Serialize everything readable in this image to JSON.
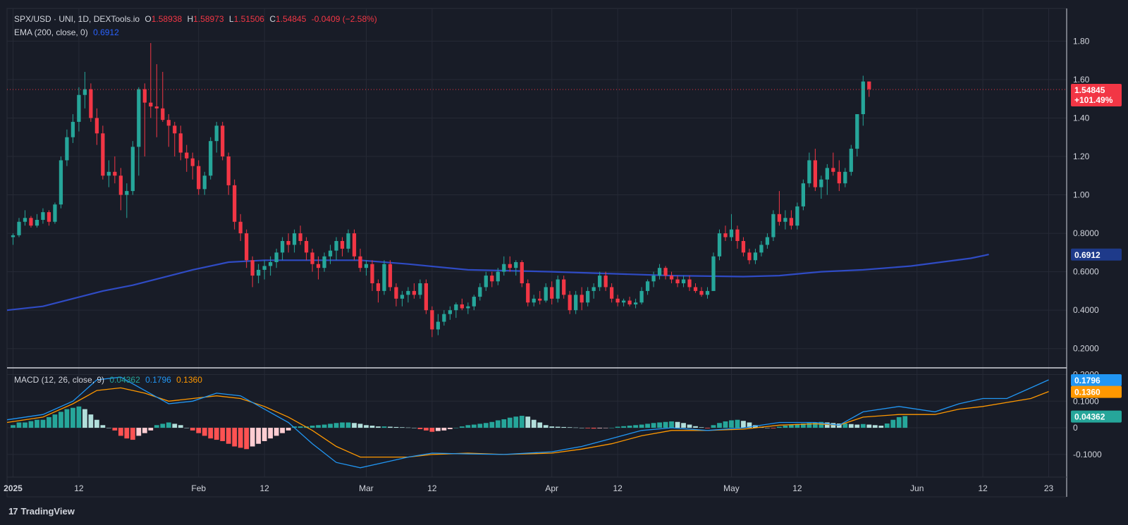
{
  "header": {
    "symbol": "SPX/USD · UNI, 1D, DEXTools.io",
    "open_label": "O",
    "open": "1.58938",
    "high_label": "H",
    "high": "1.58973",
    "low_label": "L",
    "low": "1.51506",
    "close_label": "C",
    "close": "1.54845",
    "change": "-0.0409 (−2.58%)"
  },
  "ema_legend": {
    "label": "EMA (200, close, 0)",
    "value": "0.6912"
  },
  "macd_legend": {
    "label": "MACD (12, 26, close, 9)",
    "hist": "0.04362",
    "macd": "0.1796",
    "signal": "0.1360"
  },
  "footer": {
    "brand": "TradingView",
    "logo": "17"
  },
  "colors": {
    "up": "#26a69a",
    "down": "#f23645",
    "ema": "#2f4bc4",
    "macd": "#2196f3",
    "signal": "#ff9800",
    "hist_up": "#26a69a",
    "hist_up_fade": "#b2dfdb",
    "hist_down": "#ff5252",
    "hist_down_fade": "#ffcdd2",
    "bg": "#181c27",
    "grid": "#262a36"
  },
  "chart_data": {
    "type": "candlestick",
    "price_axis": {
      "ticks": [
        "1.80",
        "1.60",
        "1.40",
        "1.20",
        "1.00",
        "0.8000",
        "0.6000",
        "0.4000",
        "0.2000"
      ],
      "tick_values": [
        1.8,
        1.6,
        1.4,
        1.2,
        1.0,
        0.8,
        0.6,
        0.4,
        0.2
      ],
      "range": [
        0.1,
        1.97
      ]
    },
    "time_axis": {
      "labels": [
        "2025",
        "12",
        "Feb",
        "12",
        "Mar",
        "12",
        "Apr",
        "12",
        "May",
        "12",
        "Jun",
        "12",
        "23"
      ],
      "label_days": [
        0,
        11,
        31,
        42,
        59,
        70,
        90,
        101,
        120,
        131,
        151,
        162,
        173
      ],
      "range": [
        -1,
        176
      ]
    },
    "last_price_badge": {
      "price": "1.54845",
      "change_pct": "+101.49%",
      "value": 1.54845
    },
    "ema_badge": {
      "price": "0.6912",
      "value": 0.6912
    },
    "ema_points": [
      [
        -1,
        0.4
      ],
      [
        5,
        0.42
      ],
      [
        10,
        0.46
      ],
      [
        15,
        0.5
      ],
      [
        20,
        0.53
      ],
      [
        25,
        0.57
      ],
      [
        30,
        0.61
      ],
      [
        36,
        0.65
      ],
      [
        42,
        0.66
      ],
      [
        50,
        0.66
      ],
      [
        58,
        0.66
      ],
      [
        66,
        0.64
      ],
      [
        76,
        0.61
      ],
      [
        90,
        0.6
      ],
      [
        100,
        0.59
      ],
      [
        110,
        0.58
      ],
      [
        122,
        0.575
      ],
      [
        128,
        0.58
      ],
      [
        135,
        0.6
      ],
      [
        142,
        0.61
      ],
      [
        150,
        0.63
      ],
      [
        155,
        0.65
      ],
      [
        160,
        0.67
      ],
      [
        163,
        0.69
      ]
    ],
    "candles_olhc": [
      [
        0.78,
        0.8,
        0.74,
        0.79
      ],
      [
        0.79,
        0.88,
        0.78,
        0.86
      ],
      [
        0.86,
        0.92,
        0.84,
        0.88
      ],
      [
        0.88,
        0.89,
        0.83,
        0.84
      ],
      [
        0.84,
        0.9,
        0.83,
        0.87
      ],
      [
        0.87,
        0.93,
        0.85,
        0.91
      ],
      [
        0.91,
        0.92,
        0.84,
        0.86
      ],
      [
        0.86,
        0.96,
        0.85,
        0.95
      ],
      [
        0.95,
        1.2,
        0.93,
        1.18
      ],
      [
        1.18,
        1.34,
        1.15,
        1.3
      ],
      [
        1.3,
        1.42,
        1.27,
        1.38
      ],
      [
        1.38,
        1.56,
        1.33,
        1.52
      ],
      [
        1.52,
        1.64,
        1.45,
        1.55
      ],
      [
        1.55,
        1.58,
        1.38,
        1.4
      ],
      [
        1.4,
        1.45,
        1.26,
        1.32
      ],
      [
        1.32,
        1.36,
        1.08,
        1.1
      ],
      [
        1.1,
        1.18,
        1.04,
        1.12
      ],
      [
        1.12,
        1.2,
        1.06,
        1.1
      ],
      [
        1.1,
        1.14,
        0.92,
        1.0
      ],
      [
        1.0,
        1.06,
        0.88,
        1.02
      ],
      [
        1.02,
        1.28,
        1.0,
        1.25
      ],
      [
        1.25,
        1.56,
        1.1,
        1.55
      ],
      [
        1.55,
        1.58,
        1.2,
        1.48
      ],
      [
        1.48,
        1.79,
        1.4,
        1.46
      ],
      [
        1.46,
        1.68,
        1.3,
        1.45
      ],
      [
        1.45,
        1.64,
        1.38,
        1.39
      ],
      [
        1.39,
        1.42,
        1.25,
        1.36
      ],
      [
        1.36,
        1.38,
        1.2,
        1.32
      ],
      [
        1.32,
        1.36,
        1.18,
        1.22
      ],
      [
        1.22,
        1.26,
        1.12,
        1.19
      ],
      [
        1.19,
        1.22,
        1.08,
        1.15
      ],
      [
        1.15,
        1.18,
        1.0,
        1.03
      ],
      [
        1.03,
        1.12,
        1.0,
        1.1
      ],
      [
        1.1,
        1.3,
        1.08,
        1.28
      ],
      [
        1.28,
        1.38,
        1.22,
        1.36
      ],
      [
        1.36,
        1.38,
        1.18,
        1.2
      ],
      [
        1.2,
        1.22,
        1.0,
        1.05
      ],
      [
        1.05,
        1.08,
        0.82,
        0.86
      ],
      [
        0.86,
        0.9,
        0.76,
        0.8
      ],
      [
        0.8,
        0.82,
        0.62,
        0.66
      ],
      [
        0.66,
        0.68,
        0.52,
        0.58
      ],
      [
        0.58,
        0.64,
        0.54,
        0.61
      ],
      [
        0.61,
        0.66,
        0.56,
        0.63
      ],
      [
        0.63,
        0.68,
        0.58,
        0.65
      ],
      [
        0.65,
        0.72,
        0.62,
        0.7
      ],
      [
        0.7,
        0.78,
        0.66,
        0.76
      ],
      [
        0.76,
        0.8,
        0.7,
        0.74
      ],
      [
        0.74,
        0.82,
        0.7,
        0.8
      ],
      [
        0.8,
        0.84,
        0.74,
        0.76
      ],
      [
        0.76,
        0.78,
        0.66,
        0.7
      ],
      [
        0.7,
        0.72,
        0.6,
        0.64
      ],
      [
        0.64,
        0.68,
        0.56,
        0.62
      ],
      [
        0.62,
        0.7,
        0.6,
        0.68
      ],
      [
        0.68,
        0.74,
        0.64,
        0.71
      ],
      [
        0.71,
        0.78,
        0.66,
        0.76
      ],
      [
        0.76,
        0.78,
        0.68,
        0.72
      ],
      [
        0.72,
        0.82,
        0.7,
        0.8
      ],
      [
        0.8,
        0.82,
        0.66,
        0.68
      ],
      [
        0.68,
        0.72,
        0.6,
        0.62
      ],
      [
        0.62,
        0.66,
        0.58,
        0.64
      ],
      [
        0.64,
        0.66,
        0.5,
        0.54
      ],
      [
        0.54,
        0.56,
        0.44,
        0.5
      ],
      [
        0.5,
        0.66,
        0.48,
        0.64
      ],
      [
        0.64,
        0.66,
        0.5,
        0.52
      ],
      [
        0.52,
        0.54,
        0.42,
        0.46
      ],
      [
        0.46,
        0.5,
        0.42,
        0.48
      ],
      [
        0.48,
        0.52,
        0.44,
        0.5
      ],
      [
        0.5,
        0.54,
        0.46,
        0.48
      ],
      [
        0.48,
        0.56,
        0.46,
        0.54
      ],
      [
        0.54,
        0.56,
        0.38,
        0.4
      ],
      [
        0.4,
        0.42,
        0.26,
        0.3
      ],
      [
        0.3,
        0.38,
        0.27,
        0.34
      ],
      [
        0.34,
        0.4,
        0.32,
        0.38
      ],
      [
        0.38,
        0.42,
        0.35,
        0.4
      ],
      [
        0.4,
        0.44,
        0.36,
        0.43
      ],
      [
        0.43,
        0.46,
        0.4,
        0.41
      ],
      [
        0.41,
        0.44,
        0.38,
        0.42
      ],
      [
        0.42,
        0.48,
        0.4,
        0.47
      ],
      [
        0.47,
        0.54,
        0.45,
        0.52
      ],
      [
        0.52,
        0.6,
        0.5,
        0.58
      ],
      [
        0.58,
        0.6,
        0.52,
        0.55
      ],
      [
        0.55,
        0.62,
        0.53,
        0.6
      ],
      [
        0.6,
        0.68,
        0.58,
        0.64
      ],
      [
        0.64,
        0.68,
        0.6,
        0.62
      ],
      [
        0.62,
        0.66,
        0.58,
        0.65
      ],
      [
        0.65,
        0.66,
        0.52,
        0.54
      ],
      [
        0.54,
        0.56,
        0.42,
        0.44
      ],
      [
        0.44,
        0.48,
        0.42,
        0.46
      ],
      [
        0.46,
        0.5,
        0.43,
        0.45
      ],
      [
        0.45,
        0.54,
        0.44,
        0.52
      ],
      [
        0.52,
        0.55,
        0.43,
        0.46
      ],
      [
        0.46,
        0.58,
        0.44,
        0.56
      ],
      [
        0.56,
        0.58,
        0.46,
        0.48
      ],
      [
        0.48,
        0.5,
        0.38,
        0.4
      ],
      [
        0.4,
        0.5,
        0.38,
        0.48
      ],
      [
        0.48,
        0.52,
        0.4,
        0.44
      ],
      [
        0.44,
        0.52,
        0.42,
        0.5
      ],
      [
        0.5,
        0.54,
        0.46,
        0.52
      ],
      [
        0.52,
        0.6,
        0.5,
        0.58
      ],
      [
        0.58,
        0.6,
        0.5,
        0.52
      ],
      [
        0.52,
        0.54,
        0.44,
        0.46
      ],
      [
        0.46,
        0.48,
        0.42,
        0.44
      ],
      [
        0.44,
        0.46,
        0.42,
        0.45
      ],
      [
        0.45,
        0.47,
        0.42,
        0.43
      ],
      [
        0.43,
        0.46,
        0.41,
        0.44
      ],
      [
        0.44,
        0.52,
        0.43,
        0.5
      ],
      [
        0.5,
        0.56,
        0.48,
        0.55
      ],
      [
        0.55,
        0.6,
        0.52,
        0.58
      ],
      [
        0.58,
        0.64,
        0.56,
        0.62
      ],
      [
        0.62,
        0.63,
        0.56,
        0.58
      ],
      [
        0.58,
        0.6,
        0.54,
        0.56
      ],
      [
        0.56,
        0.58,
        0.52,
        0.54
      ],
      [
        0.54,
        0.58,
        0.52,
        0.56
      ],
      [
        0.56,
        0.58,
        0.5,
        0.52
      ],
      [
        0.52,
        0.54,
        0.49,
        0.5
      ],
      [
        0.5,
        0.52,
        0.47,
        0.48
      ],
      [
        0.48,
        0.52,
        0.46,
        0.5
      ],
      [
        0.5,
        0.7,
        0.5,
        0.68
      ],
      [
        0.68,
        0.82,
        0.66,
        0.8
      ],
      [
        0.8,
        0.84,
        0.76,
        0.78
      ],
      [
        0.78,
        0.9,
        0.76,
        0.82
      ],
      [
        0.82,
        0.84,
        0.72,
        0.76
      ],
      [
        0.76,
        0.78,
        0.68,
        0.7
      ],
      [
        0.7,
        0.72,
        0.64,
        0.66
      ],
      [
        0.66,
        0.72,
        0.64,
        0.7
      ],
      [
        0.7,
        0.76,
        0.68,
        0.74
      ],
      [
        0.74,
        0.8,
        0.72,
        0.78
      ],
      [
        0.78,
        0.92,
        0.76,
        0.9
      ],
      [
        0.9,
        1.02,
        0.84,
        0.86
      ],
      [
        0.86,
        0.92,
        0.82,
        0.88
      ],
      [
        0.88,
        0.92,
        0.82,
        0.84
      ],
      [
        0.84,
        0.96,
        0.82,
        0.94
      ],
      [
        0.94,
        1.08,
        0.92,
        1.06
      ],
      [
        1.06,
        1.22,
        1.04,
        1.18
      ],
      [
        1.18,
        1.24,
        1.02,
        1.04
      ],
      [
        1.04,
        1.1,
        0.98,
        1.08
      ],
      [
        1.08,
        1.16,
        1.0,
        1.14
      ],
      [
        1.14,
        1.22,
        1.1,
        1.12
      ],
      [
        1.12,
        1.18,
        1.02,
        1.06
      ],
      [
        1.06,
        1.14,
        1.04,
        1.12
      ],
      [
        1.12,
        1.26,
        1.1,
        1.24
      ],
      [
        1.24,
        1.4,
        1.2,
        1.42
      ],
      [
        1.42,
        1.62,
        1.36,
        1.59
      ],
      [
        1.59,
        1.59,
        1.51,
        1.55
      ]
    ],
    "macd_panel": {
      "ticks": [
        "0.2000",
        "0.1000",
        "0",
        "-0.1000"
      ],
      "tick_values": [
        0.2,
        0.1,
        0.0,
        -0.1
      ],
      "range": [
        -0.185,
        0.225
      ],
      "macd_badge": "0.1796",
      "signal_badge": "0.1360",
      "hist_badge": "0.04362",
      "macd_points": [
        [
          -1,
          0.03
        ],
        [
          5,
          0.05
        ],
        [
          10,
          0.1
        ],
        [
          14,
          0.18
        ],
        [
          18,
          0.19
        ],
        [
          22,
          0.14
        ],
        [
          26,
          0.09
        ],
        [
          30,
          0.1
        ],
        [
          34,
          0.13
        ],
        [
          38,
          0.12
        ],
        [
          42,
          0.07
        ],
        [
          46,
          0.02
        ],
        [
          50,
          -0.06
        ],
        [
          54,
          -0.13
        ],
        [
          58,
          -0.15
        ],
        [
          62,
          -0.13
        ],
        [
          66,
          -0.11
        ],
        [
          70,
          -0.095
        ],
        [
          76,
          -0.098
        ],
        [
          82,
          -0.1
        ],
        [
          90,
          -0.09
        ],
        [
          95,
          -0.07
        ],
        [
          100,
          -0.04
        ],
        [
          105,
          -0.01
        ],
        [
          110,
          0.0
        ],
        [
          116,
          -0.01
        ],
        [
          122,
          0.0
        ],
        [
          128,
          0.02
        ],
        [
          134,
          0.02
        ],
        [
          138,
          0.01
        ],
        [
          142,
          0.06
        ],
        [
          148,
          0.08
        ],
        [
          154,
          0.06
        ],
        [
          158,
          0.09
        ],
        [
          162,
          0.11
        ],
        [
          166,
          0.11
        ],
        [
          170,
          0.15
        ],
        [
          173,
          0.18
        ]
      ],
      "signal_points": [
        [
          -1,
          0.02
        ],
        [
          5,
          0.04
        ],
        [
          10,
          0.09
        ],
        [
          14,
          0.14
        ],
        [
          18,
          0.15
        ],
        [
          22,
          0.13
        ],
        [
          26,
          0.1
        ],
        [
          30,
          0.11
        ],
        [
          34,
          0.12
        ],
        [
          38,
          0.11
        ],
        [
          42,
          0.08
        ],
        [
          46,
          0.04
        ],
        [
          50,
          -0.01
        ],
        [
          54,
          -0.07
        ],
        [
          58,
          -0.11
        ],
        [
          62,
          -0.11
        ],
        [
          66,
          -0.11
        ],
        [
          70,
          -0.1
        ],
        [
          76,
          -0.095
        ],
        [
          82,
          -0.1
        ],
        [
          90,
          -0.095
        ],
        [
          95,
          -0.08
        ],
        [
          100,
          -0.06
        ],
        [
          105,
          -0.03
        ],
        [
          110,
          -0.01
        ],
        [
          116,
          -0.01
        ],
        [
          122,
          -0.005
        ],
        [
          128,
          0.01
        ],
        [
          134,
          0.015
        ],
        [
          138,
          0.01
        ],
        [
          142,
          0.04
        ],
        [
          148,
          0.05
        ],
        [
          154,
          0.05
        ],
        [
          158,
          0.07
        ],
        [
          162,
          0.08
        ],
        [
          166,
          0.095
        ],
        [
          170,
          0.11
        ],
        [
          173,
          0.136
        ]
      ],
      "histogram": [
        0.01,
        0.02,
        0.02,
        0.025,
        0.03,
        0.03,
        0.04,
        0.05,
        0.06,
        0.07,
        0.075,
        0.08,
        0.07,
        0.05,
        0.03,
        0.01,
        0.0,
        -0.01,
        -0.03,
        -0.04,
        -0.045,
        -0.03,
        -0.02,
        -0.01,
        0.01,
        0.015,
        0.02,
        0.015,
        0.01,
        0.0,
        -0.01,
        -0.02,
        -0.03,
        -0.04,
        -0.045,
        -0.05,
        -0.06,
        -0.07,
        -0.075,
        -0.08,
        -0.07,
        -0.06,
        -0.05,
        -0.04,
        -0.03,
        -0.02,
        -0.01,
        0.005,
        0.005,
        0.005,
        0.008,
        0.01,
        0.012,
        0.015,
        0.018,
        0.02,
        0.02,
        0.018,
        0.015,
        0.01,
        0.008,
        0.005,
        0.005,
        0.004,
        0.003,
        0.002,
        0.001,
        0.0,
        -0.005,
        -0.01,
        -0.015,
        -0.012,
        -0.01,
        -0.005,
        0.0,
        0.005,
        0.01,
        0.012,
        0.015,
        0.018,
        0.022,
        0.028,
        0.032,
        0.038,
        0.042,
        0.045,
        0.042,
        0.03,
        0.02,
        0.01,
        0.005,
        0.004,
        0.003,
        0.002,
        0.001,
        0.0,
        -0.002,
        -0.003,
        -0.002,
        -0.001,
        0.0,
        0.004,
        0.006,
        0.008,
        0.01,
        0.012,
        0.015,
        0.018,
        0.02,
        0.022,
        0.024,
        0.022,
        0.018,
        0.012,
        0.006,
        0.002,
        -0.002,
        0.01,
        0.018,
        0.024,
        0.028,
        0.03,
        0.026,
        0.02,
        0.01,
        0.004,
        0.0,
        -0.002,
        0.004,
        0.008,
        0.012,
        0.014,
        0.016,
        0.018,
        0.02,
        0.022,
        0.02,
        0.018,
        0.016,
        0.016,
        0.014,
        0.012,
        0.014,
        0.012,
        0.01,
        0.008,
        0.016,
        0.03,
        0.04,
        0.044
      ]
    }
  }
}
